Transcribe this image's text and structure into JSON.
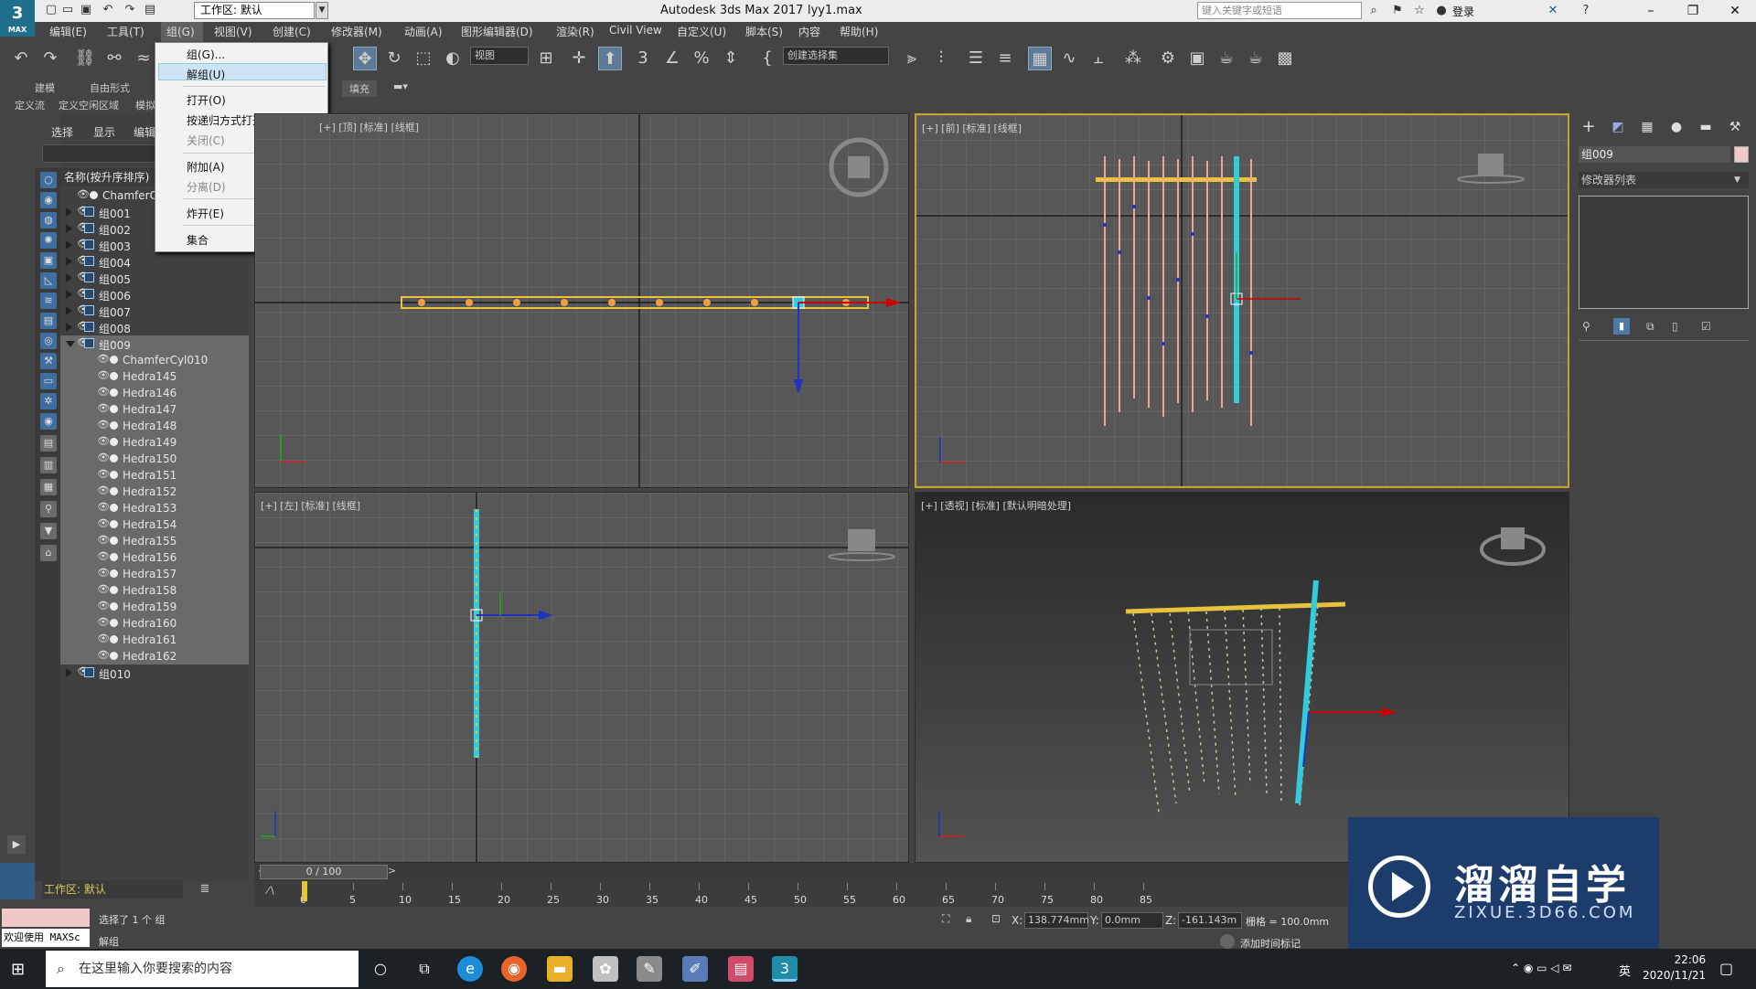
{
  "titlebar": {
    "app_title": "Autodesk 3ds Max 2017",
    "file_title": "lyy1.max",
    "workspace_select": "工作区: 默认",
    "search_placeholder": "键入关键字或短语",
    "login": "登录"
  },
  "logo": {
    "text": "3",
    "sub": "MAX"
  },
  "menubar": {
    "items": [
      "编辑(E)",
      "工具(T)",
      "组(G)",
      "视图(V)",
      "创建(C)",
      "修改器(M)",
      "动画(A)",
      "图形编辑器(D)",
      "渲染(R)",
      "Civil View",
      "自定义(U)",
      "脚本(S)",
      "内容",
      "帮助(H)"
    ]
  },
  "toolbar": {
    "view_dropdown": "视图",
    "selection_set_dropdown": "创建选择集"
  },
  "ribbon": {
    "tabs_row1": [
      "建模",
      "自由形式"
    ],
    "tabs_row2": [
      "定义流",
      "定义空闲区域",
      "模拟"
    ],
    "fill_tab": "填充"
  },
  "group_menu": {
    "items": [
      {
        "label": "组(G)...",
        "disabled": false
      },
      {
        "label": "解组(U)",
        "disabled": false,
        "highlighted": true
      },
      {
        "label": "打开(O)",
        "disabled": false
      },
      {
        "label": "按递归方式打开(R)",
        "disabled": false
      },
      {
        "label": "关闭(C)",
        "disabled": true
      },
      {
        "label": "附加(A)",
        "disabled": false
      },
      {
        "label": "分离(D)",
        "disabled": true
      },
      {
        "label": "炸开(E)",
        "disabled": false
      },
      {
        "label": "集合",
        "disabled": false,
        "submenu": true
      }
    ]
  },
  "explorer": {
    "tabs": [
      "选择",
      "显示",
      "编辑"
    ],
    "column_header": "名称(按升序排序)",
    "rows": [
      {
        "label": "ChamferCyl",
        "indent": 0,
        "type": "obj"
      },
      {
        "label": "组001",
        "indent": 0,
        "type": "group"
      },
      {
        "label": "组002",
        "indent": 0,
        "type": "group"
      },
      {
        "label": "组003",
        "indent": 0,
        "type": "group"
      },
      {
        "label": "组004",
        "indent": 0,
        "type": "group"
      },
      {
        "label": "组005",
        "indent": 0,
        "type": "group"
      },
      {
        "label": "组006",
        "indent": 0,
        "type": "group"
      },
      {
        "label": "组007",
        "indent": 0,
        "type": "group"
      },
      {
        "label": "组008",
        "indent": 0,
        "type": "group"
      },
      {
        "label": "组009",
        "indent": 0,
        "type": "group",
        "expanded": true,
        "selected": true
      },
      {
        "label": "ChamferCyl010",
        "indent": 1,
        "type": "obj",
        "selected": true
      },
      {
        "label": "Hedra145",
        "indent": 1,
        "type": "obj",
        "selected": true
      },
      {
        "label": "Hedra146",
        "indent": 1,
        "type": "obj",
        "selected": true
      },
      {
        "label": "Hedra147",
        "indent": 1,
        "type": "obj",
        "selected": true
      },
      {
        "label": "Hedra148",
        "indent": 1,
        "type": "obj",
        "selected": true
      },
      {
        "label": "Hedra149",
        "indent": 1,
        "type": "obj",
        "selected": true
      },
      {
        "label": "Hedra150",
        "indent": 1,
        "type": "obj",
        "selected": true
      },
      {
        "label": "Hedra151",
        "indent": 1,
        "type": "obj",
        "selected": true
      },
      {
        "label": "Hedra152",
        "indent": 1,
        "type": "obj",
        "selected": true
      },
      {
        "label": "Hedra153",
        "indent": 1,
        "type": "obj",
        "selected": true
      },
      {
        "label": "Hedra154",
        "indent": 1,
        "type": "obj",
        "selected": true
      },
      {
        "label": "Hedra155",
        "indent": 1,
        "type": "obj",
        "selected": true
      },
      {
        "label": "Hedra156",
        "indent": 1,
        "type": "obj",
        "selected": true
      },
      {
        "label": "Hedra157",
        "indent": 1,
        "type": "obj",
        "selected": true
      },
      {
        "label": "Hedra158",
        "indent": 1,
        "type": "obj",
        "selected": true
      },
      {
        "label": "Hedra159",
        "indent": 1,
        "type": "obj",
        "selected": true
      },
      {
        "label": "Hedra160",
        "indent": 1,
        "type": "obj",
        "selected": true
      },
      {
        "label": "Hedra161",
        "indent": 1,
        "type": "obj",
        "selected": true
      },
      {
        "label": "Hedra162",
        "indent": 1,
        "type": "obj",
        "selected": true
      },
      {
        "label": "组010",
        "indent": 0,
        "type": "group"
      }
    ],
    "workspace_footer": "工作区: 默认"
  },
  "viewports": {
    "top_label": "[+] [顶] [标准] [线框]",
    "front_label": "[+] [前] [标准] [线框]",
    "left_label": "[+] [左] [标准] [线框]",
    "persp_label": "[+] [透视] [标准] [默认明暗处理]"
  },
  "right_panel": {
    "object_name": "组009",
    "modifier_list": "修改器列表",
    "color_swatch": "#f0c8c8"
  },
  "timeline": {
    "slider_text": "0 / 100",
    "ticks": [
      "0",
      "5",
      "10",
      "15",
      "20",
      "25",
      "30",
      "35",
      "40",
      "45",
      "50",
      "55",
      "60",
      "65",
      "70",
      "75",
      "80",
      "85"
    ]
  },
  "status": {
    "maxscript": "欢迎使用 MAXSc",
    "selected_text": "选择了 1 个 组",
    "prompt_text": "解组",
    "x_label": "X:",
    "x_value": "138.774mm",
    "y_label": "Y:",
    "y_value": "0.0mm",
    "z_label": "Z:",
    "z_value": "-161.143m",
    "grid_text": "栅格 = 100.0mm",
    "add_time_tag": "添加时间标记"
  },
  "taskbar": {
    "search_text": "在这里输入你要搜索的内容",
    "time": "22:06",
    "date": "2020/11/21",
    "ime": "英"
  },
  "watermark": {
    "title": "溜溜自学",
    "sub": "ZIXUE.3D66.COM"
  }
}
